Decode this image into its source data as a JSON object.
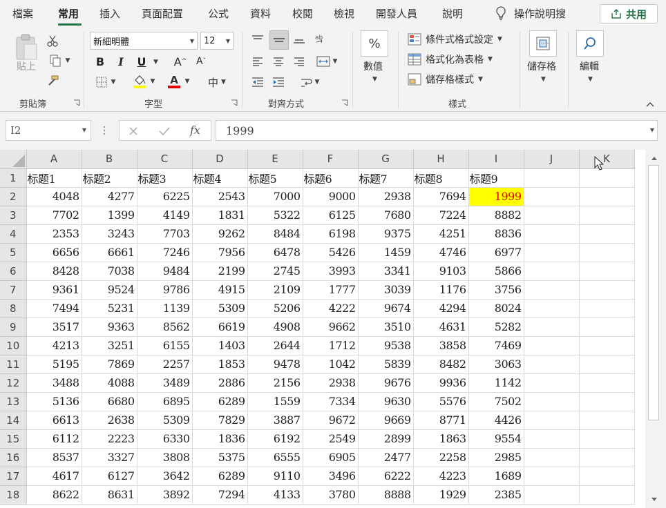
{
  "tabs": [
    {
      "label": "檔案",
      "active": false
    },
    {
      "label": "常用",
      "active": true
    },
    {
      "label": "插入",
      "active": false
    },
    {
      "label": "頁面配置",
      "active": false
    },
    {
      "label": "公式",
      "active": false
    },
    {
      "label": "資料",
      "active": false
    },
    {
      "label": "校閱",
      "active": false
    },
    {
      "label": "檢視",
      "active": false
    },
    {
      "label": "開發人員",
      "active": false
    },
    {
      "label": "說明",
      "active": false
    }
  ],
  "tell_me": "操作說明搜",
  "share_label": "共用",
  "ribbon": {
    "clipboard": {
      "label": "剪貼簿",
      "paste_label": "貼上"
    },
    "font": {
      "label": "字型",
      "font_name": "新細明體",
      "font_size": "12",
      "bold": "B",
      "italic": "I",
      "underline": "U",
      "grow": "A",
      "shrink": "A",
      "phonetic": "中",
      "font_color": "#e00000",
      "fill_color": "#ffff00"
    },
    "alignment": {
      "label": "對齊方式"
    },
    "number": {
      "label": "數值",
      "percent": "%"
    },
    "styles": {
      "label": "樣式",
      "conditional": "條件式格式設定",
      "format_table": "格式化為表格",
      "cell_styles": "儲存格樣式"
    },
    "cells": {
      "label": "儲存格"
    },
    "editing": {
      "label": "編輯"
    }
  },
  "formula_bar": {
    "name_box": "I2",
    "fx": "fx",
    "value": "1999"
  },
  "sheet": {
    "columns": [
      "A",
      "B",
      "C",
      "D",
      "E",
      "F",
      "G",
      "H",
      "I",
      "J",
      "K"
    ],
    "headers": [
      "标题1",
      "标题2",
      "标题3",
      "标题4",
      "标题5",
      "标题6",
      "标题7",
      "标题8",
      "标题9"
    ],
    "rows": [
      [
        4048,
        4277,
        6225,
        2543,
        7000,
        9000,
        2938,
        7694,
        1999
      ],
      [
        7702,
        1399,
        4149,
        1831,
        5322,
        6125,
        7680,
        7224,
        8882
      ],
      [
        2353,
        3243,
        7703,
        9262,
        8484,
        6198,
        9375,
        4251,
        8836
      ],
      [
        6656,
        6661,
        7246,
        7956,
        6478,
        5426,
        1459,
        4746,
        6977
      ],
      [
        8428,
        7038,
        9484,
        2199,
        2745,
        3993,
        3341,
        9103,
        5866
      ],
      [
        9361,
        9524,
        9786,
        4915,
        2109,
        1777,
        3039,
        1176,
        3756
      ],
      [
        7494,
        5231,
        1139,
        5309,
        5206,
        4222,
        9674,
        4294,
        8024
      ],
      [
        3517,
        9363,
        8562,
        6619,
        4908,
        9662,
        3510,
        4631,
        5282
      ],
      [
        4213,
        3251,
        6155,
        1403,
        2644,
        1712,
        9538,
        3858,
        7469
      ],
      [
        5195,
        7869,
        2257,
        1853,
        9478,
        1042,
        5839,
        8482,
        3063
      ],
      [
        3488,
        4088,
        3489,
        2886,
        2156,
        2938,
        9676,
        9936,
        1142
      ],
      [
        5136,
        6680,
        6895,
        6289,
        1559,
        7334,
        9630,
        5576,
        7502
      ],
      [
        6613,
        2638,
        5309,
        7829,
        3887,
        9672,
        9669,
        8771,
        4426
      ],
      [
        6112,
        2223,
        6330,
        1836,
        6192,
        2549,
        2899,
        1863,
        9554
      ],
      [
        8537,
        3327,
        3808,
        5375,
        6555,
        6905,
        2477,
        2258,
        2985
      ],
      [
        4617,
        6127,
        3642,
        6289,
        9110,
        3496,
        6222,
        4223,
        1689
      ],
      [
        8622,
        8631,
        3892,
        7294,
        4133,
        3780,
        8888,
        1929,
        2385
      ]
    ],
    "highlight": {
      "fill": "#ffff00",
      "text": "#e00000"
    }
  }
}
